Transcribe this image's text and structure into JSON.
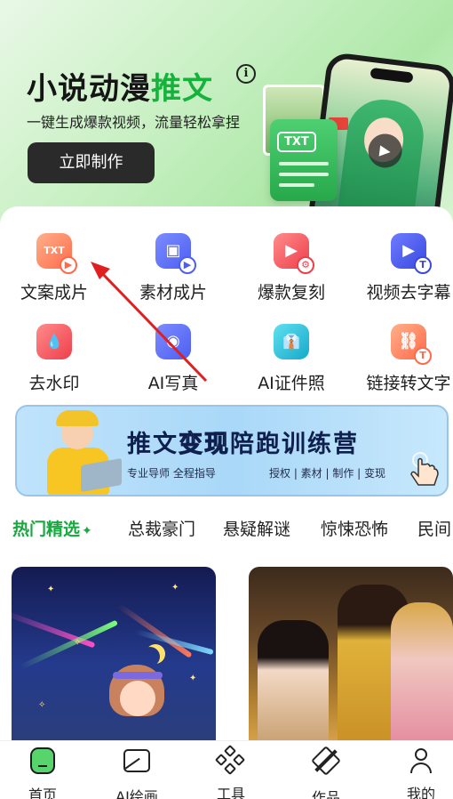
{
  "hero": {
    "title_main": "小说动漫",
    "title_accent": "推文",
    "info_glyph": "i",
    "subtitle": "一键生成爆款视频，流量轻松拿捏",
    "cta_label": "立即制作",
    "card_label": "TXT",
    "play_glyph": "▶"
  },
  "features": [
    {
      "label": "文案成片",
      "icon": "text-to-video-icon",
      "glyph": "TXT",
      "badge": "▶"
    },
    {
      "label": "素材成片",
      "icon": "material-to-video-icon",
      "glyph": "▣",
      "badge": "▶"
    },
    {
      "label": "爆款复刻",
      "icon": "viral-copy-icon",
      "glyph": "▶",
      "badge": "⚙"
    },
    {
      "label": "视频去字幕",
      "icon": "remove-subtitle-icon",
      "glyph": "▶",
      "badge": "T"
    },
    {
      "label": "去水印",
      "icon": "remove-watermark-icon",
      "glyph": "💧",
      "badge": ""
    },
    {
      "label": "AI写真",
      "icon": "ai-portrait-icon",
      "glyph": "◉",
      "badge": ""
    },
    {
      "label": "AI证件照",
      "icon": "id-photo-icon",
      "glyph": "👔",
      "badge": ""
    },
    {
      "label": "链接转文字",
      "icon": "link-to-text-icon",
      "glyph": "⛓",
      "badge": "T"
    }
  ],
  "banner": {
    "title_1": "推文",
    "title_hl": "变现",
    "title_2": "陪跑训练营",
    "left_text": "专业导师 全程指导",
    "right_text": "授权 | 素材 | 制作 | 变现"
  },
  "tabs": [
    {
      "label": "热门精选",
      "active": true
    },
    {
      "label": "总裁豪门",
      "active": false
    },
    {
      "label": "悬疑解谜",
      "active": false
    },
    {
      "label": "惊悚恐怖",
      "active": false
    },
    {
      "label": "民间",
      "active": false
    }
  ],
  "tab_sparkle": "✦",
  "bottom_nav": [
    {
      "label": "首页",
      "icon": "home-icon",
      "active": true
    },
    {
      "label": "AI绘画",
      "icon": "ai-paint-icon",
      "active": false
    },
    {
      "label": "工具",
      "icon": "tools-icon",
      "active": false
    },
    {
      "label": "作品",
      "icon": "works-icon",
      "active": false
    },
    {
      "label": "我的",
      "icon": "profile-icon",
      "active": false
    }
  ],
  "colors": {
    "accent_green": "#17a83f",
    "annotation_red": "#e02020"
  }
}
